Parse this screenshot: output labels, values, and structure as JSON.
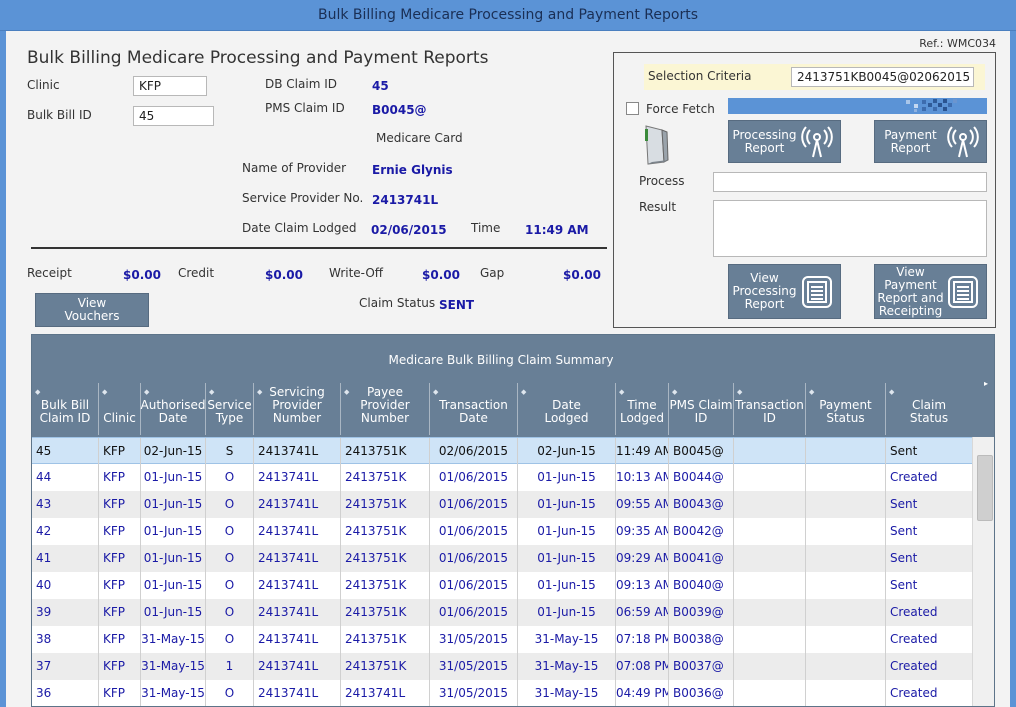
{
  "window": {
    "title": "Bulk Billing Medicare Processing and Payment Reports"
  },
  "ref": "Ref.: WMC034",
  "header": {
    "title": "Bulk Billing Medicare Processing and Payment Reports",
    "clinic_label": "Clinic",
    "clinic_value": "KFP",
    "bulk_bill_id_label": "Bulk Bill ID",
    "bulk_bill_id_value": "45",
    "db_claim_id_label": "DB Claim ID",
    "db_claim_id_value": "45",
    "pms_claim_id_label": "PMS Claim ID",
    "pms_claim_id_value": "B0045@",
    "medicare_card_label": "Medicare Card",
    "provider_name_label": "Name of Provider",
    "provider_name_value": "Ernie Glynis",
    "service_provider_label": "Service Provider No.",
    "service_provider_value": "2413741L",
    "date_lodged_label": "Date Claim Lodged",
    "date_lodged_value": "02/06/2015",
    "time_label": "Time",
    "time_value": "11:49 AM"
  },
  "totals": {
    "receipt_label": "Receipt",
    "receipt_value": "$0.00",
    "credit_label": "Credit",
    "credit_value": "$0.00",
    "writeoff_label": "Write-Off",
    "writeoff_value": "$0.00",
    "gap_label": "Gap",
    "gap_value": "$0.00",
    "claim_status_label": "Claim Status",
    "claim_status_value": "SENT"
  },
  "buttons": {
    "view_vouchers_1": "View",
    "view_vouchers_2": "Vouchers",
    "processing_report_1": "Processing",
    "processing_report_2": "Report",
    "payment_report_1": "Payment",
    "payment_report_2": "Report",
    "view_processing_1": "View",
    "view_processing_2": "Processing",
    "view_processing_3": "Report",
    "view_payment_1": "View",
    "view_payment_2": "Payment",
    "view_payment_3": "Report and",
    "view_payment_4": "Receipting"
  },
  "panel": {
    "selection_criteria_label": "Selection Criteria",
    "selection_criteria_value": "2413751KB0045@02062015",
    "force_fetch_label": "Force Fetch",
    "force_fetch_checked": false,
    "process_label": "Process",
    "process_value": "",
    "result_label": "Result",
    "result_value": ""
  },
  "grid": {
    "title": "Medicare Bulk Billing Claim Summary",
    "columns": [
      {
        "l1": "Bulk Bill",
        "l2": "Claim ID",
        "l3": ""
      },
      {
        "l1": "Clinic",
        "l2": "",
        "l3": ""
      },
      {
        "l1": "Authorised",
        "l2": "Date",
        "l3": ""
      },
      {
        "l1": "Service",
        "l2": "Type",
        "l3": ""
      },
      {
        "l1": "Servicing",
        "l2": "Provider",
        "l3": "Number"
      },
      {
        "l1": "Payee",
        "l2": "Provider",
        "l3": "Number"
      },
      {
        "l1": "Transaction",
        "l2": "Date",
        "l3": ""
      },
      {
        "l1": "Date",
        "l2": "Lodged",
        "l3": ""
      },
      {
        "l1": "Time",
        "l2": "Lodged",
        "l3": ""
      },
      {
        "l1": "PMS Claim",
        "l2": "ID",
        "l3": ""
      },
      {
        "l1": "Transaction",
        "l2": "ID",
        "l3": ""
      },
      {
        "l1": "Payment",
        "l2": "Status",
        "l3": ""
      },
      {
        "l1": "Claim",
        "l2": "Status",
        "l3": ""
      }
    ],
    "rows": [
      [
        "45",
        "KFP",
        "02-Jun-15",
        "S",
        "2413741L",
        "2413751K",
        "02/06/2015",
        "02-Jun-15",
        "11:49 AM",
        "B0045@",
        "",
        "",
        "Sent"
      ],
      [
        "44",
        "KFP",
        "01-Jun-15",
        "O",
        "2413741L",
        "2413751K",
        "01/06/2015",
        "01-Jun-15",
        "10:13 AM",
        "B0044@",
        "",
        "",
        "Created"
      ],
      [
        "43",
        "KFP",
        "01-Jun-15",
        "O",
        "2413741L",
        "2413751K",
        "01/06/2015",
        "01-Jun-15",
        "09:55 AM",
        "B0043@",
        "",
        "",
        "Sent"
      ],
      [
        "42",
        "KFP",
        "01-Jun-15",
        "O",
        "2413741L",
        "2413751K",
        "01/06/2015",
        "01-Jun-15",
        "09:35 AM",
        "B0042@",
        "",
        "",
        "Sent"
      ],
      [
        "41",
        "KFP",
        "01-Jun-15",
        "O",
        "2413741L",
        "2413751K",
        "01/06/2015",
        "01-Jun-15",
        "09:29 AM",
        "B0041@",
        "",
        "",
        "Sent"
      ],
      [
        "40",
        "KFP",
        "01-Jun-15",
        "O",
        "2413741L",
        "2413751K",
        "01/06/2015",
        "01-Jun-15",
        "09:13 AM",
        "B0040@",
        "",
        "",
        "Sent"
      ],
      [
        "39",
        "KFP",
        "01-Jun-15",
        "O",
        "2413741L",
        "2413751K",
        "01/06/2015",
        "01-Jun-15",
        "06:59 AM",
        "B0039@",
        "",
        "",
        "Created"
      ],
      [
        "38",
        "KFP",
        "31-May-15",
        "O",
        "2413741L",
        "2413751K",
        "31/05/2015",
        "31-May-15",
        "07:18 PM",
        "B0038@",
        "",
        "",
        "Created"
      ],
      [
        "37",
        "KFP",
        "31-May-15",
        "1",
        "2413741L",
        "2413751K",
        "31/05/2015",
        "31-May-15",
        "07:08 PM",
        "B0037@",
        "",
        "",
        "Created"
      ],
      [
        "36",
        "KFP",
        "31-May-15",
        "O",
        "2413741L",
        "2413741L",
        "31/05/2015",
        "31-May-15",
        "04:49 PM",
        "B0036@",
        "",
        "",
        "Created"
      ]
    ],
    "selected_row": 0
  },
  "icons": {
    "radio": "wireless-signal-icon",
    "doc": "document-report-icon",
    "card_reader": "card-reader-icon"
  }
}
